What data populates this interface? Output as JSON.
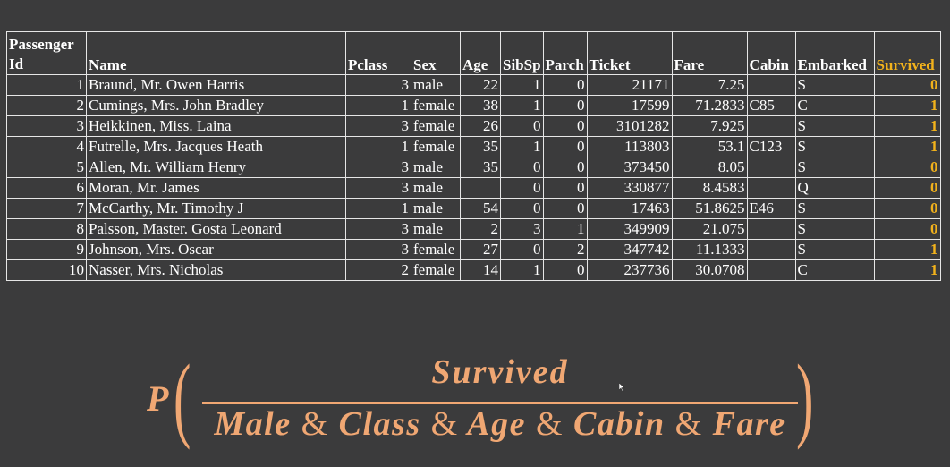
{
  "table": {
    "headers": [
      {
        "line1": "Passenger",
        "line2": "Id"
      },
      {
        "line1": "",
        "line2": "Name"
      },
      {
        "line1": "",
        "line2": "Pclass"
      },
      {
        "line1": "",
        "line2": "Sex"
      },
      {
        "line1": "",
        "line2": "Age"
      },
      {
        "line1": "",
        "line2": "SibSp"
      },
      {
        "line1": "",
        "line2": "Parch"
      },
      {
        "line1": "",
        "line2": "Ticket"
      },
      {
        "line1": "",
        "line2": "Fare"
      },
      {
        "line1": "",
        "line2": "Cabin"
      },
      {
        "line1": "",
        "line2": "Embarked"
      },
      {
        "line1": "",
        "line2": "Survived"
      }
    ],
    "rows": [
      [
        "1",
        "Braund, Mr. Owen Harris",
        "3",
        "male",
        "22",
        "1",
        "0",
        "21171",
        "7.25",
        "",
        "S",
        "0"
      ],
      [
        "2",
        "Cumings, Mrs. John Bradley",
        "1",
        "female",
        "38",
        "1",
        "0",
        "17599",
        "71.2833",
        "C85",
        "C",
        "1"
      ],
      [
        "3",
        "Heikkinen, Miss. Laina",
        "3",
        "female",
        "26",
        "0",
        "0",
        "3101282",
        "7.925",
        "",
        "S",
        "1"
      ],
      [
        "4",
        "Futrelle, Mrs. Jacques Heath",
        "1",
        "female",
        "35",
        "1",
        "0",
        "113803",
        "53.1",
        "C123",
        "S",
        "1"
      ],
      [
        "5",
        "Allen, Mr. William Henry",
        "3",
        "male",
        "35",
        "0",
        "0",
        "373450",
        "8.05",
        "",
        "S",
        "0"
      ],
      [
        "6",
        "Moran, Mr. James",
        "3",
        "male",
        "",
        "0",
        "0",
        "330877",
        "8.4583",
        "",
        "Q",
        "0"
      ],
      [
        "7",
        "McCarthy, Mr. Timothy J",
        "1",
        "male",
        "54",
        "0",
        "0",
        "17463",
        "51.8625",
        "E46",
        "S",
        "0"
      ],
      [
        "8",
        "Palsson, Master. Gosta Leonard",
        "3",
        "male",
        "2",
        "3",
        "1",
        "349909",
        "21.075",
        "",
        "S",
        "0"
      ],
      [
        "9",
        "Johnson, Mrs. Oscar",
        "3",
        "female",
        "27",
        "0",
        "2",
        "347742",
        "11.1333",
        "",
        "S",
        "1"
      ],
      [
        "10",
        "Nasser, Mrs. Nicholas",
        "2",
        "female",
        "14",
        "1",
        "0",
        "237736",
        "30.0708",
        "",
        "C",
        "1"
      ]
    ]
  },
  "formula": {
    "prefix": "P",
    "open_paren": "(",
    "close_paren": ")",
    "numerator": "Survived",
    "denominator": [
      "Male",
      "Class",
      "Age",
      "Cabin",
      "Fare"
    ],
    "joiner": "&"
  },
  "colors": {
    "background": "#3b3b3c",
    "survived_accent": "#f2b21c",
    "formula": "#f0a773"
  }
}
